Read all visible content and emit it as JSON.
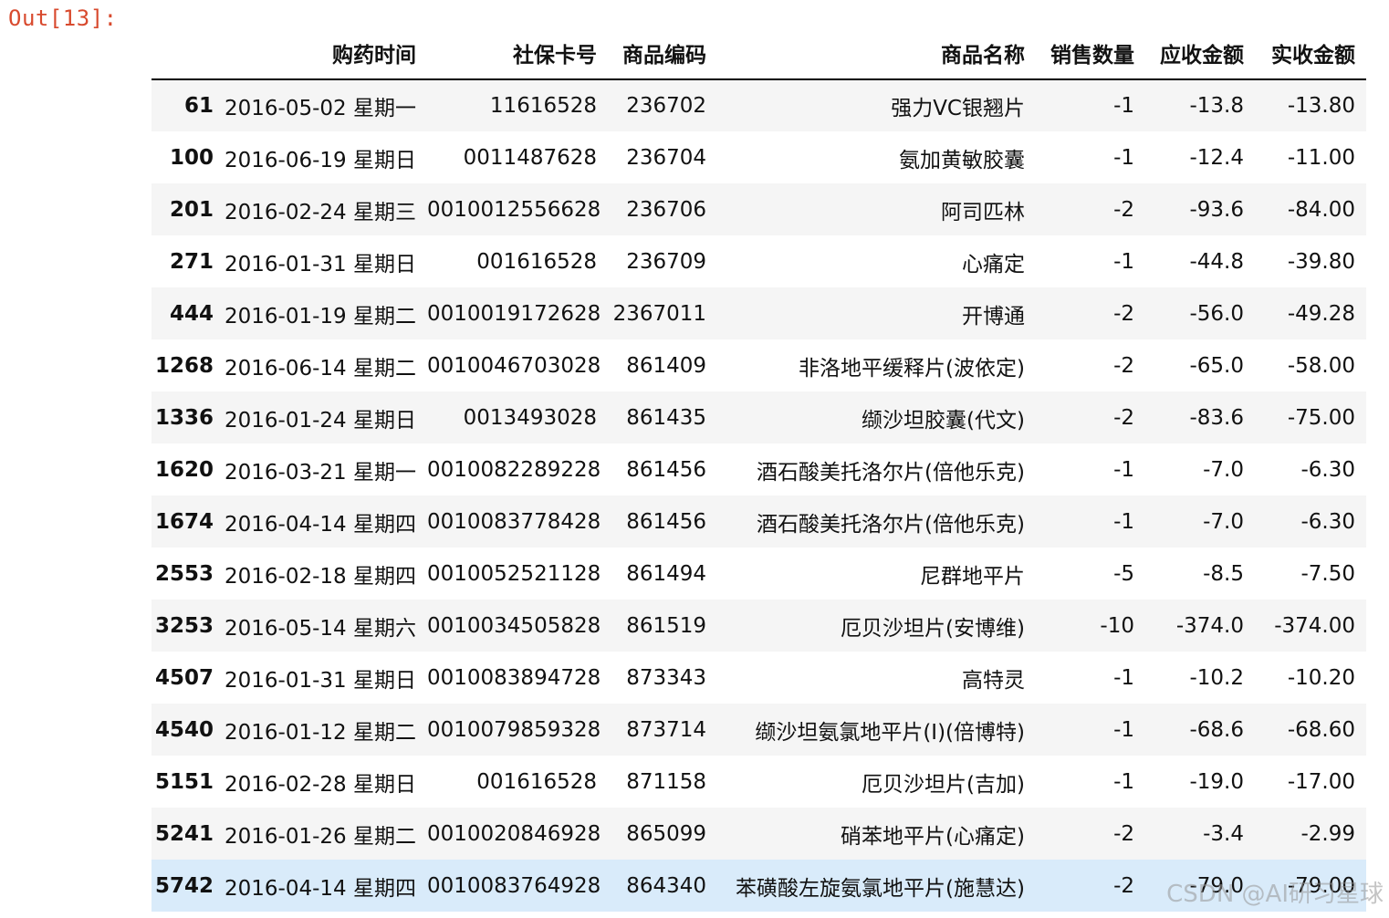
{
  "cell": {
    "prompt": "Out[13]:"
  },
  "table": {
    "columns": [
      "",
      "购药时间",
      "社保卡号",
      "商品编码",
      "商品名称",
      "销售数量",
      "应收金额",
      "实收金额"
    ],
    "rows": [
      {
        "index": "61",
        "cells": [
          "2016-05-02 星期一",
          "11616528",
          "236702",
          "强力VC银翘片",
          "-1",
          "-13.8",
          "-13.80"
        ]
      },
      {
        "index": "100",
        "cells": [
          "2016-06-19 星期日",
          "0011487628",
          "236704",
          "氨加黄敏胶囊",
          "-1",
          "-12.4",
          "-11.00"
        ]
      },
      {
        "index": "201",
        "cells": [
          "2016-02-24 星期三",
          "0010012556628",
          "236706",
          "阿司匹林",
          "-2",
          "-93.6",
          "-84.00"
        ]
      },
      {
        "index": "271",
        "cells": [
          "2016-01-31 星期日",
          "001616528",
          "236709",
          "心痛定",
          "-1",
          "-44.8",
          "-39.80"
        ]
      },
      {
        "index": "444",
        "cells": [
          "2016-01-19 星期二",
          "0010019172628",
          "2367011",
          "开博通",
          "-2",
          "-56.0",
          "-49.28"
        ]
      },
      {
        "index": "1268",
        "cells": [
          "2016-06-14 星期二",
          "0010046703028",
          "861409",
          "非洛地平缓释片(波依定)",
          "-2",
          "-65.0",
          "-58.00"
        ]
      },
      {
        "index": "1336",
        "cells": [
          "2016-01-24 星期日",
          "0013493028",
          "861435",
          "缬沙坦胶囊(代文)",
          "-2",
          "-83.6",
          "-75.00"
        ]
      },
      {
        "index": "1620",
        "cells": [
          "2016-03-21 星期一",
          "0010082289228",
          "861456",
          "酒石酸美托洛尔片(倍他乐克)",
          "-1",
          "-7.0",
          "-6.30"
        ]
      },
      {
        "index": "1674",
        "cells": [
          "2016-04-14 星期四",
          "0010083778428",
          "861456",
          "酒石酸美托洛尔片(倍他乐克)",
          "-1",
          "-7.0",
          "-6.30"
        ]
      },
      {
        "index": "2553",
        "cells": [
          "2016-02-18 星期四",
          "0010052521128",
          "861494",
          "尼群地平片",
          "-5",
          "-8.5",
          "-7.50"
        ]
      },
      {
        "index": "3253",
        "cells": [
          "2016-05-14 星期六",
          "0010034505828",
          "861519",
          "厄贝沙坦片(安博维)",
          "-10",
          "-374.0",
          "-374.00"
        ]
      },
      {
        "index": "4507",
        "cells": [
          "2016-01-31 星期日",
          "0010083894728",
          "873343",
          "高特灵",
          "-1",
          "-10.2",
          "-10.20"
        ]
      },
      {
        "index": "4540",
        "cells": [
          "2016-01-12 星期二",
          "0010079859328",
          "873714",
          "缬沙坦氨氯地平片(I)(倍博特)",
          "-1",
          "-68.6",
          "-68.60"
        ]
      },
      {
        "index": "5151",
        "cells": [
          "2016-02-28 星期日",
          "001616528",
          "871158",
          "厄贝沙坦片(吉加)",
          "-1",
          "-19.0",
          "-17.00"
        ]
      },
      {
        "index": "5241",
        "cells": [
          "2016-01-26 星期二",
          "0010020846928",
          "865099",
          "硝苯地平片(心痛定)",
          "-2",
          "-3.4",
          "-2.99"
        ]
      },
      {
        "index": "5742",
        "cells": [
          "2016-04-14 星期四",
          "0010083764928",
          "864340",
          "苯磺酸左旋氨氯地平片(施慧达)",
          "-2",
          "-79.0",
          "-79.00"
        ]
      }
    ],
    "hovered_row_index": "5742"
  },
  "watermark": {
    "text": "CSDN @AI研习星球"
  }
}
